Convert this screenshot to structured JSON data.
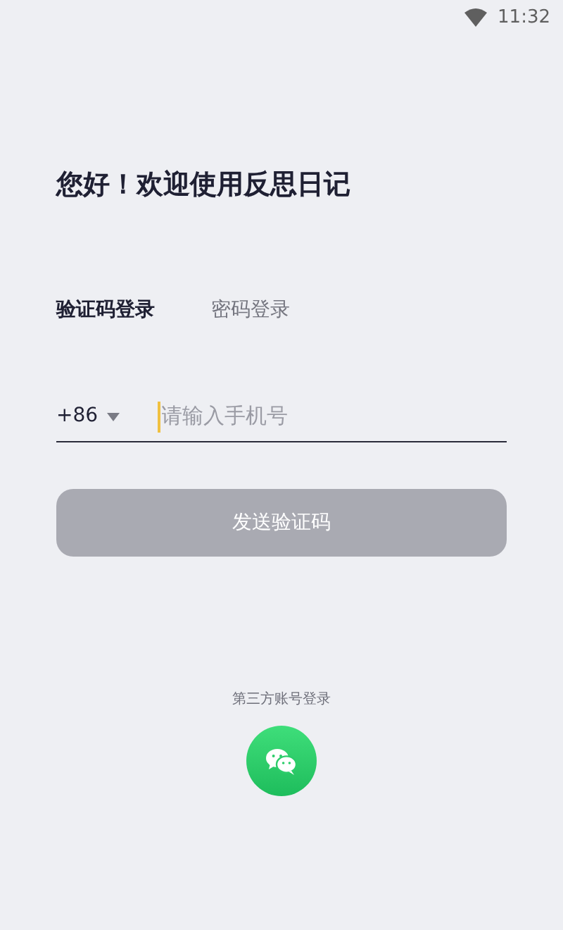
{
  "status_bar": {
    "time": "11:32"
  },
  "title": "您好！欢迎使用反思日记",
  "tabs": [
    {
      "label": "验证码登录",
      "selected": true
    },
    {
      "label": "密码登录",
      "selected": false
    }
  ],
  "phone": {
    "country_code": "+86",
    "placeholder": "请输入手机号"
  },
  "send_button": {
    "label": "发送验证码",
    "disabled": true
  },
  "third_party": {
    "label": "第三方账号登录"
  }
}
